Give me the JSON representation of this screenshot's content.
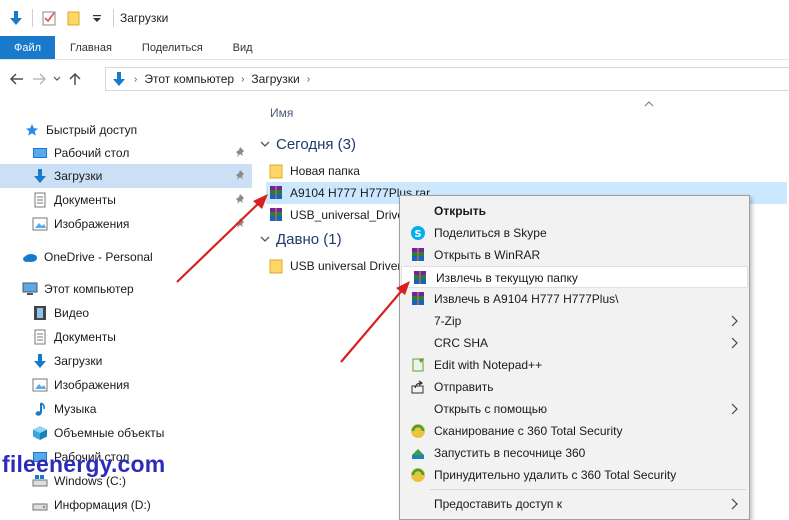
{
  "window": {
    "title": "Загрузки"
  },
  "ribbon": {
    "tabs": [
      "Файл",
      "Главная",
      "Поделиться",
      "Вид"
    ]
  },
  "address": {
    "crumbs": [
      "Этот компьютер",
      "Загрузки"
    ]
  },
  "navpane": {
    "quick_access": "Быстрый доступ",
    "quick_items": [
      "Рабочий стол",
      "Загрузки",
      "Документы",
      "Изображения"
    ],
    "onedrive": "OneDrive - Personal",
    "this_pc": "Этот компьютер",
    "pc_items": [
      "Видео",
      "Документы",
      "Загрузки",
      "Изображения",
      "Музыка",
      "Объемные объекты",
      "Рабочий стол",
      "Windows (C:)",
      "Информация (D:)"
    ],
    "selected": "Загрузки"
  },
  "content": {
    "column_name": "Имя",
    "groups": [
      {
        "label": "Сегодня (3)",
        "items": [
          "Новая папка",
          "A9104 H777 H777Plus.rar",
          "USB_universal_Driver"
        ]
      },
      {
        "label": "Давно (1)",
        "items": [
          "USB universal Driver"
        ]
      }
    ]
  },
  "context_menu": {
    "items": [
      "Открыть",
      "Поделиться в Skype",
      "Открыть в WinRAR",
      "Извлечь в текущую папку",
      "Извлечь в A9104 H777 H777Plus\\",
      "7-Zip",
      "CRC SHA",
      "Edit with Notepad++",
      "Отправить",
      "Открыть с помощью",
      "Сканирование с 360 Total Security",
      "Запустить в песочнице 360",
      "Принудительно удалить с  360 Total Security",
      "Предоставить доступ к"
    ],
    "highlighted": "Извлечь в текущую папку"
  },
  "watermark": "fileenergy.com",
  "colors": {
    "accent": "#1979ca",
    "selection": "#cce8ff",
    "arrow": "#d92020",
    "watermark": "#2c2cb8"
  }
}
